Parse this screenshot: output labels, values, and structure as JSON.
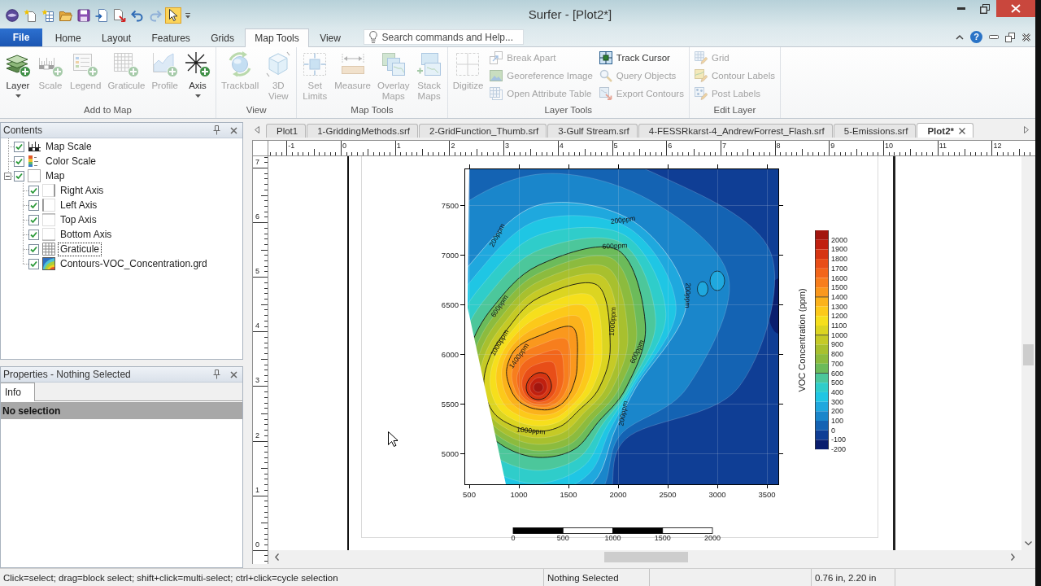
{
  "window": {
    "title": "Surfer - [Plot2*]"
  },
  "quick_access": {
    "pointer_tool_active": true
  },
  "ribbon": {
    "file_button": "File",
    "tabs": [
      {
        "label": "Home",
        "selected": false
      },
      {
        "label": "Layout",
        "selected": false
      },
      {
        "label": "Features",
        "selected": false
      },
      {
        "label": "Grids",
        "selected": false
      },
      {
        "label": "Map Tools",
        "selected": true
      },
      {
        "label": "View",
        "selected": false
      }
    ],
    "search": {
      "placeholder": "Search commands and Help..."
    },
    "help_button": "?",
    "groups": [
      {
        "label": "Add to Map",
        "commands": [
          {
            "label": "Layer",
            "kind": "large",
            "disabled": false,
            "dropdown": true
          },
          {
            "label": "Scale",
            "kind": "large",
            "disabled": true,
            "dropdown": false
          },
          {
            "label": "Legend",
            "kind": "large",
            "disabled": true,
            "dropdown": false
          },
          {
            "label": "Graticule",
            "kind": "large",
            "disabled": true,
            "dropdown": false
          },
          {
            "label": "Profile",
            "kind": "large",
            "disabled": true,
            "dropdown": false
          },
          {
            "label": "Axis",
            "kind": "large",
            "disabled": false,
            "dropdown": true
          }
        ]
      },
      {
        "label": "View",
        "commands": [
          {
            "label": "Trackball",
            "kind": "large",
            "disabled": true
          },
          {
            "label": "3D View",
            "kind": "large",
            "disabled": true
          }
        ]
      },
      {
        "label": "Map Tools",
        "commands": [
          {
            "label": "Set Limits",
            "kind": "large",
            "disabled": true
          },
          {
            "label": "Measure",
            "kind": "large",
            "disabled": true
          },
          {
            "label": "Overlay Maps",
            "kind": "large",
            "disabled": true
          },
          {
            "label": "Stack Maps",
            "kind": "large",
            "disabled": true
          }
        ]
      },
      {
        "label": "Layer Tools",
        "commands": [
          {
            "label": "Digitize",
            "kind": "large",
            "disabled": true
          },
          {
            "label": "Break Apart",
            "kind": "small",
            "disabled": true
          },
          {
            "label": "Georeference Image",
            "kind": "small",
            "disabled": true
          },
          {
            "label": "Open Attribute Table",
            "kind": "small",
            "disabled": true
          },
          {
            "label": "Track Cursor",
            "kind": "small",
            "disabled": false
          },
          {
            "label": "Query Objects",
            "kind": "small",
            "disabled": true
          },
          {
            "label": "Export Contours",
            "kind": "small",
            "disabled": true
          }
        ]
      },
      {
        "label": "Edit Layer",
        "commands": [
          {
            "label": "Grid",
            "kind": "small",
            "disabled": true
          },
          {
            "label": "Contour Labels",
            "kind": "small",
            "disabled": true
          },
          {
            "label": "Post Labels",
            "kind": "small",
            "disabled": true
          }
        ]
      }
    ]
  },
  "contents": {
    "title": "Contents",
    "items": [
      {
        "label": "Map Scale",
        "checked": true,
        "focused": false
      },
      {
        "label": "Color Scale",
        "checked": true,
        "focused": false
      },
      {
        "label": "Map",
        "checked": true,
        "focused": false,
        "expanded": true,
        "children": [
          {
            "label": "Right Axis",
            "checked": true,
            "focused": false
          },
          {
            "label": "Left Axis",
            "checked": true,
            "focused": false
          },
          {
            "label": "Top Axis",
            "checked": true,
            "focused": false
          },
          {
            "label": "Bottom Axis",
            "checked": true,
            "focused": false
          },
          {
            "label": "Graticule",
            "checked": true,
            "focused": true
          },
          {
            "label": "Contours-VOC_Concentration.grd",
            "checked": true,
            "focused": false
          }
        ]
      }
    ]
  },
  "properties": {
    "title": "Properties - Nothing Selected",
    "tabs": [
      {
        "label": "Info",
        "selected": true
      }
    ],
    "section": "No selection"
  },
  "document_tabs": [
    {
      "label": "Plot1",
      "selected": false
    },
    {
      "label": "1-GriddingMethods.srf",
      "selected": false
    },
    {
      "label": "2-GridFunction_Thumb.srf",
      "selected": false
    },
    {
      "label": "3-Gulf Stream.srf",
      "selected": false
    },
    {
      "label": "4-FESSRkarst-4_AndrewForrest_Flash.srf",
      "selected": false
    },
    {
      "label": "5-Emissions.srf",
      "selected": false
    },
    {
      "label": "Plot2*",
      "selected": true
    }
  ],
  "rulers": {
    "horizontal": [
      "-1",
      "0",
      "1",
      "2",
      "3",
      "4",
      "5",
      "6",
      "7",
      "8",
      "9",
      "10",
      "11",
      "12"
    ],
    "vertical": [
      "7",
      "6",
      "5",
      "4",
      "3",
      "2",
      "1",
      "0"
    ]
  },
  "plot": {
    "map": {
      "x_tick_labels": [
        "500",
        "1000",
        "1500",
        "2000",
        "2500",
        "3000",
        "3500"
      ],
      "y_tick_labels": [
        "7500",
        "7000",
        "6500",
        "6000",
        "5500",
        "5000"
      ],
      "contour_labels": [
        "200ppm",
        "600ppm",
        "200ppm",
        "200ppm",
        "600ppm",
        "1000ppm",
        "1400ppm",
        "1000ppm",
        "600ppm",
        "1000ppm",
        "200ppm"
      ]
    },
    "color_scale": {
      "title": "VOC Concentration (ppm)",
      "levels": [
        {
          "label": "2000",
          "color": "#a3160f"
        },
        {
          "label": "1900",
          "color": "#c0200f"
        },
        {
          "label": "1800",
          "color": "#d63512"
        },
        {
          "label": "1700",
          "color": "#e84e18"
        },
        {
          "label": "1600",
          "color": "#f2661b"
        },
        {
          "label": "1500",
          "color": "#f77e1d"
        },
        {
          "label": "1400",
          "color": "#fa981d"
        },
        {
          "label": "1300",
          "color": "#fbb21b"
        },
        {
          "label": "1200",
          "color": "#fcc91a"
        },
        {
          "label": "1100",
          "color": "#f6df1c"
        },
        {
          "label": "1000",
          "color": "#dcd521"
        },
        {
          "label": "900",
          "color": "#c5ca26"
        },
        {
          "label": "800",
          "color": "#a8c02e"
        },
        {
          "label": "700",
          "color": "#8cbb3e"
        },
        {
          "label": "600",
          "color": "#6cbb5a"
        },
        {
          "label": "500",
          "color": "#4cc79b"
        },
        {
          "label": "400",
          "color": "#2fcdca"
        },
        {
          "label": "300",
          "color": "#1fc6e4"
        },
        {
          "label": "200",
          "color": "#1fa8de"
        },
        {
          "label": "100",
          "color": "#1a86cb"
        },
        {
          "label": "0",
          "color": "#1463b3"
        },
        {
          "label": "-100",
          "color": "#0f3e95"
        },
        {
          "label": "-200",
          "color": "#0a1e6e"
        }
      ]
    },
    "scale_bar": {
      "labels": [
        "0",
        "500",
        "1000",
        "1500",
        "2000"
      ]
    }
  },
  "status_bar": {
    "hint": "Click=select; drag=block select; shift+click=multi-select; ctrl+click=cycle selection",
    "selection": "Nothing Selected",
    "position": "0.76 in, 2.20 in"
  }
}
